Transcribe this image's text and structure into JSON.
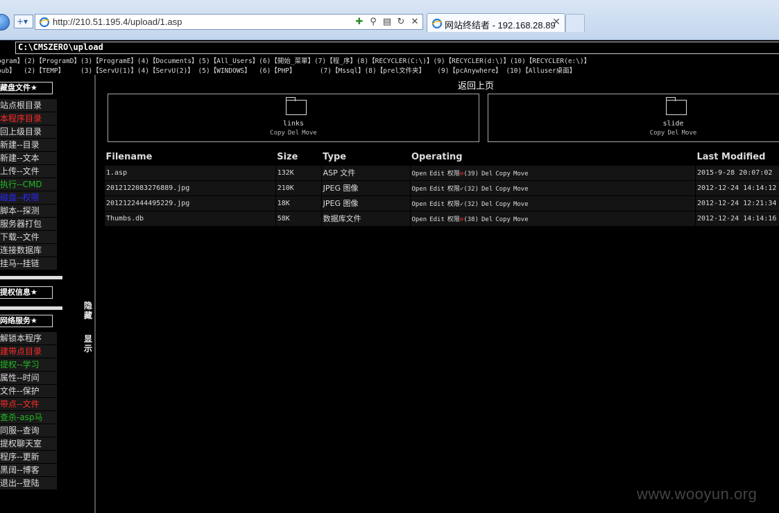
{
  "browser": {
    "url": "http://210.51.195.4/upload/1.asp",
    "tab_title": "网站终结者 - 192.168.28.89",
    "tab_close": "✕"
  },
  "page": {
    "path": "C:\\CMSZERO\\upload",
    "quick_links_row1": "ogram】(2)【ProgramD】(3)【ProgramE】(4)【Documents】(5)【All_Users】(6)【開始_菜單】(7)【程_序】(8)【RECYCLER(C:\\)】(9)【RECYCLER(d:\\)】(10)【RECYCLER(e:\\)】",
    "quick_links_row2": "pub】  (2)【TEMP】    (3)【ServU(1)】(4)【ServU(2)】 (5)【WINDOWS】  (6)【PHP】      (7)【Mssql】(8)【prel文件夹】   (9)【pcAnywhere】 (10)【Alluser桌面】",
    "back_link": "返回上页"
  },
  "sidebar": {
    "section1_title": "藏盘文件★",
    "section1_items": [
      {
        "label": "站点根目录",
        "color": "#dddddd"
      },
      {
        "label": "本程序目录",
        "color": "#ff2a2a"
      },
      {
        "label": "回上级目录",
        "color": "#dddddd"
      },
      {
        "label": "新建--目录",
        "color": "#dddddd"
      },
      {
        "label": "新建--文本",
        "color": "#dddddd"
      },
      {
        "label": "上传--文件",
        "color": "#dddddd"
      },
      {
        "label": "执行--CMD",
        "color": "#22bb22"
      },
      {
        "label": "磁盘--权限",
        "color": "#2a2aff"
      },
      {
        "label": "脚本--探测",
        "color": "#dddddd"
      },
      {
        "label": "服务器打包",
        "color": "#dddddd"
      },
      {
        "label": "下载--文件",
        "color": "#dddddd"
      },
      {
        "label": "连接数据库",
        "color": "#dddddd"
      },
      {
        "label": "挂马--挂链",
        "color": "#dddddd"
      }
    ],
    "section2_title": "提权信息★",
    "section3_title": "网络服务★",
    "section3_items": [
      {
        "label": "解锁本程序",
        "color": "#dddddd"
      },
      {
        "label": "建带点目录",
        "color": "#ff2a2a"
      },
      {
        "label": "提权--学习",
        "color": "#22bb22"
      },
      {
        "label": "属性--时间",
        "color": "#dddddd"
      },
      {
        "label": "文件--保护",
        "color": "#dddddd"
      },
      {
        "label": "带点--文件",
        "color": "#ff2a2a"
      },
      {
        "label": "查杀-asp马",
        "color": "#22bb22"
      },
      {
        "label": "同服--查询",
        "color": "#dddddd"
      },
      {
        "label": "提权聊天室",
        "color": "#dddddd"
      },
      {
        "label": "程序--更新",
        "color": "#dddddd"
      },
      {
        "label": "黑阔--博客",
        "color": "#dddddd"
      },
      {
        "label": "退出--登陆",
        "color": "#dddddd"
      }
    ],
    "hide_label": "隐藏",
    "show_label": "显示"
  },
  "folders": [
    {
      "name": "links",
      "actions": [
        "Copy",
        "Del",
        "Move"
      ]
    },
    {
      "name": "slide",
      "actions": [
        "Copy",
        "Del",
        "Move"
      ]
    }
  ],
  "table": {
    "headers": [
      "Filename",
      "Size",
      "Type",
      "Operating",
      "Last Modified"
    ],
    "rows": [
      {
        "name": "1.asp",
        "size": "132K",
        "type": "ASP 文件",
        "open": "Open",
        "edit": "Edit",
        "perm": "权限",
        "perm_mark": "⊘",
        "perm_ok": false,
        "perm_code": "(39)",
        "del": "Del",
        "copy": "Copy",
        "move": "Move",
        "modified": "2015-9-28 20:07:02"
      },
      {
        "name": "2012122083276889.jpg",
        "size": "210K",
        "type": "JPEG 图像",
        "open": "Open",
        "edit": "Edit",
        "perm": "权限",
        "perm_mark": "✓",
        "perm_ok": true,
        "perm_code": "(32)",
        "del": "Del",
        "copy": "Copy",
        "move": "Move",
        "modified": "2012-12-24 14:14:12"
      },
      {
        "name": "2012122444495229.jpg",
        "size": "18K",
        "type": "JPEG 图像",
        "open": "Open",
        "edit": "Edit",
        "perm": "权限",
        "perm_mark": "✓",
        "perm_ok": true,
        "perm_code": "(32)",
        "del": "Del",
        "copy": "Copy",
        "move": "Move",
        "modified": "2012-12-24 12:21:34"
      },
      {
        "name": "Thumbs.db",
        "size": "58K",
        "type": "数据库文件",
        "open": "Open",
        "edit": "Edit",
        "perm": "权限",
        "perm_mark": "⊘",
        "perm_ok": false,
        "perm_code": "(38)",
        "del": "Del",
        "copy": "Copy",
        "move": "Move",
        "modified": "2012-12-24 14:14:16"
      }
    ]
  },
  "watermark": "www.wooyun.org"
}
